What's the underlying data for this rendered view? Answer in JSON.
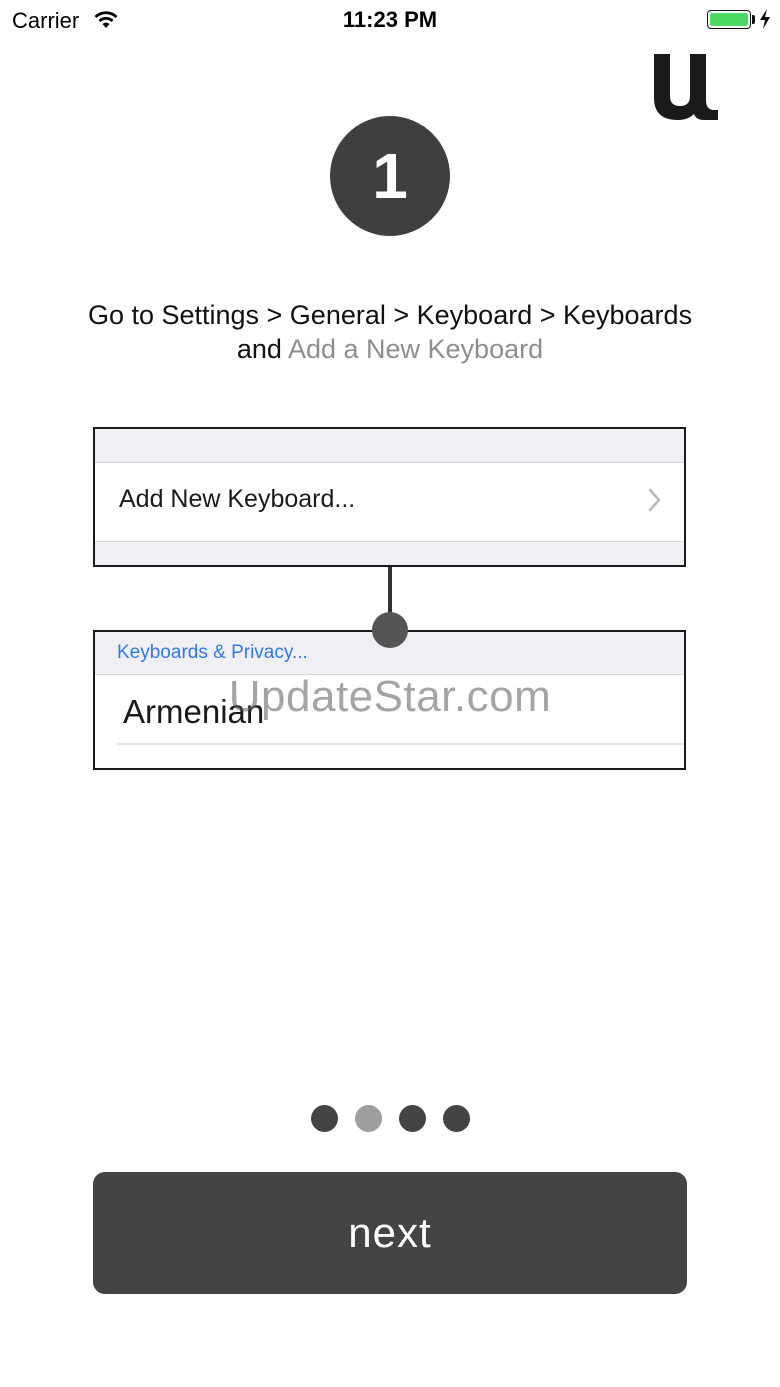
{
  "status_bar": {
    "carrier": "Carrier",
    "time": "11:23 PM",
    "battery_color": "#4cd964"
  },
  "logo": {
    "icon": "u-logo-icon"
  },
  "step": {
    "number": "1"
  },
  "instructions": {
    "line1": "Go to Settings > General > Keyboard > Keyboards",
    "line2_prefix": "and",
    "line2_highlight": "Add a New Keyboard"
  },
  "illustration": {
    "top_card_row": "Add New Keyboard...",
    "bottom_card_section": "Keyboards & Privacy...",
    "bottom_card_language": "Armenian",
    "section_link_color": "#2f7ae5"
  },
  "watermark": "UpdateStar.com",
  "pager": {
    "count": 4,
    "active_index": 1
  },
  "next_button": {
    "label": "next",
    "color": "#444444"
  }
}
